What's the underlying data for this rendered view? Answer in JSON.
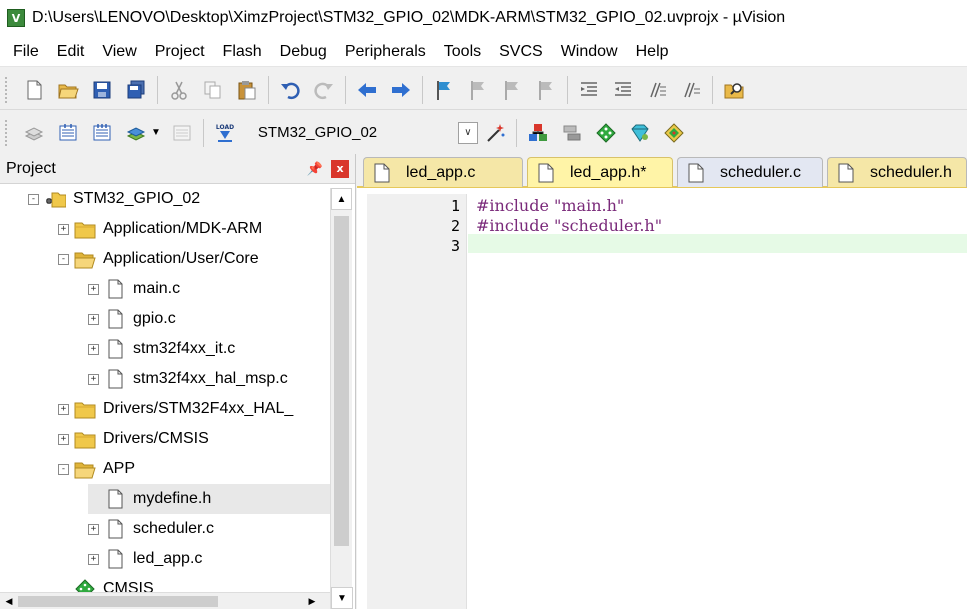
{
  "window": {
    "title": "D:\\Users\\LENOVO\\Desktop\\XimzProject\\STM32_GPIO_02\\MDK-ARM\\STM32_GPIO_02.uvprojx - µVision",
    "icon_label": "V"
  },
  "menu": [
    "File",
    "Edit",
    "View",
    "Project",
    "Flash",
    "Debug",
    "Peripherals",
    "Tools",
    "SVCS",
    "Window",
    "Help"
  ],
  "toolbar2": {
    "target": "STM32_GPIO_02",
    "load_label": "LOAD"
  },
  "project_panel": {
    "title": "Project",
    "pin": "⬇",
    "close": "x",
    "tree": [
      {
        "label": "STM32_GPIO_02",
        "level": 0,
        "expander": "-",
        "icon": "target-icon"
      },
      {
        "label": "Application/MDK-ARM",
        "level": 1,
        "expander": "+",
        "icon": "folder-icon"
      },
      {
        "label": "Application/User/Core",
        "level": 1,
        "expander": "-",
        "icon": "folder-open-icon"
      },
      {
        "label": "main.c",
        "level": 2,
        "expander": "+",
        "icon": "file-icon"
      },
      {
        "label": "gpio.c",
        "level": 2,
        "expander": "+",
        "icon": "file-icon"
      },
      {
        "label": "stm32f4xx_it.c",
        "level": 2,
        "expander": "+",
        "icon": "file-icon"
      },
      {
        "label": "stm32f4xx_hal_msp.c",
        "level": 2,
        "expander": "+",
        "icon": "file-icon"
      },
      {
        "label": "Drivers/STM32F4xx_HAL_",
        "level": 1,
        "expander": "+",
        "icon": "folder-icon"
      },
      {
        "label": "Drivers/CMSIS",
        "level": 1,
        "expander": "+",
        "icon": "folder-icon"
      },
      {
        "label": "APP",
        "level": 1,
        "expander": "-",
        "icon": "folder-open-icon"
      },
      {
        "label": "mydefine.h",
        "level": 2,
        "expander": "",
        "icon": "file-icon"
      },
      {
        "label": "scheduler.c",
        "level": 2,
        "expander": "+",
        "icon": "file-icon"
      },
      {
        "label": "led_app.c",
        "level": 2,
        "expander": "+",
        "icon": "file-icon"
      },
      {
        "label": "CMSIS",
        "level": 1,
        "expander": "",
        "icon": "cmsis-icon"
      }
    ]
  },
  "editor": {
    "tabs": [
      "led_app.c",
      "led_app.h*",
      "scheduler.c",
      "scheduler.h"
    ],
    "active_tab": 1,
    "line_numbers": [
      "1",
      "2",
      "3"
    ],
    "lines": [
      {
        "directive": "#include",
        "arg": "\"main.h\""
      },
      {
        "directive": "#include",
        "arg": "\"scheduler.h\""
      },
      {
        "directive": "",
        "arg": ""
      }
    ]
  },
  "colors": {
    "directive": "#7a2a7a",
    "current_line": "#e6fae6",
    "tab_active": "#fff4a7"
  }
}
